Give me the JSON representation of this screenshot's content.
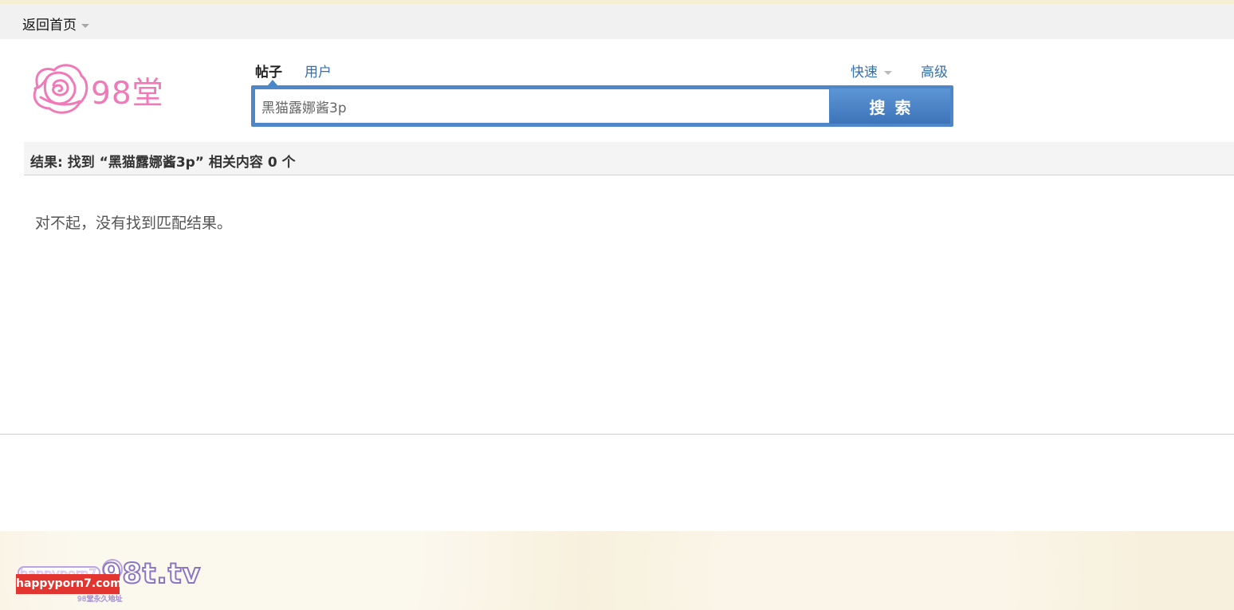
{
  "topbar": {
    "home_label": "返回首页"
  },
  "logo": {
    "text": "98堂",
    "icon": "rose-logo-icon",
    "color": "#f07ab8"
  },
  "search": {
    "tabs": [
      {
        "label": "帖子",
        "active": true
      },
      {
        "label": "用户",
        "active": false
      }
    ],
    "quick_label": "快速",
    "advanced_label": "高级",
    "query": "黑猫露娜酱3p",
    "button_label": "搜索"
  },
  "results": {
    "summary_prefix": "结果: 找到 ",
    "summary_query": "“黑猫露娜酱3p”",
    "summary_suffix": " 相关内容 ",
    "count": "0",
    "unit": " 个",
    "empty_message": "对不起，没有找到匹配结果。"
  },
  "footer": {
    "domain": "98t.tv",
    "badge": "happyporn7.com",
    "subtext": "98堂永久地址",
    "watermark": "happyporn7"
  },
  "colors": {
    "accent": "#4d87c8",
    "link": "#366fab",
    "result_bg": "#f4f4f4",
    "footer_bg": "#f7f0dc"
  }
}
